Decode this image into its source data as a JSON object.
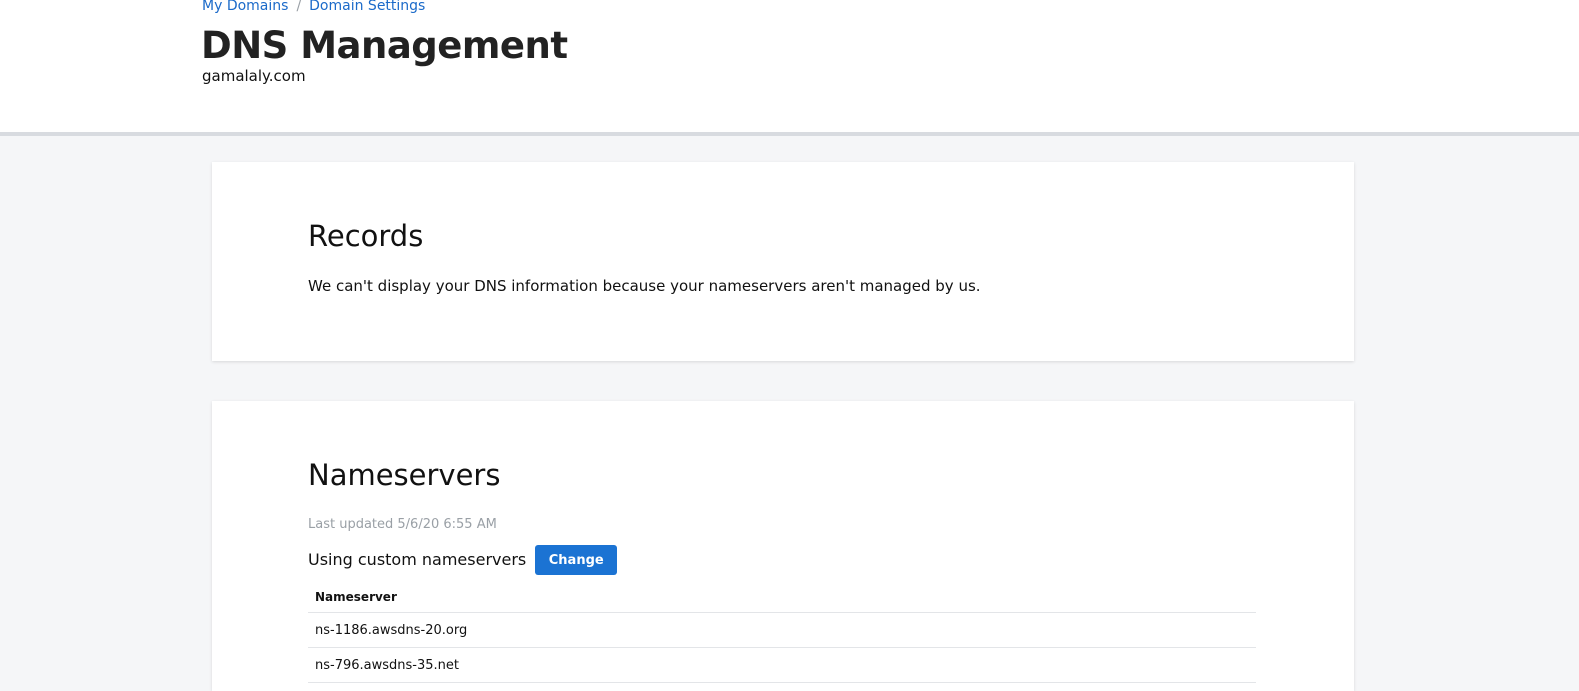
{
  "breadcrumb": {
    "items": [
      {
        "label": "My Domains"
      },
      {
        "label": "Domain Settings"
      }
    ],
    "separator": "/"
  },
  "header": {
    "title": "DNS Management",
    "domain": "gamalaly.com"
  },
  "records": {
    "title": "Records",
    "message": "We can't display your DNS information because your nameservers aren't managed by us."
  },
  "nameservers": {
    "title": "Nameservers",
    "last_updated": "Last updated 5/6/20 6:55 AM",
    "status_label": "Using custom nameservers",
    "change_label": "Change",
    "table": {
      "column_header": "Nameserver",
      "rows": [
        "ns-1186.awsdns-20.org",
        "ns-796.awsdns-35.net"
      ]
    }
  },
  "colors": {
    "link": "#1b6ac9",
    "button": "#1b73d3",
    "background": "#f5f6f8",
    "muted_text": "#9aa0a6"
  }
}
